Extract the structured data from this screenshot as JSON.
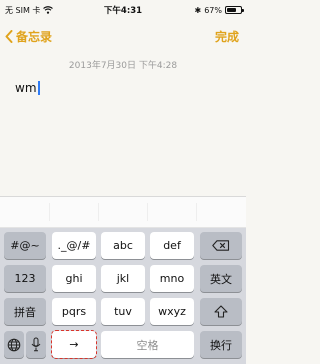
{
  "status": {
    "carrier": "无 SIM 卡",
    "time": "下午4:31",
    "bluetooth": "✱",
    "battery": "67%",
    "battery_level": 0.67
  },
  "nav": {
    "back_label": "备忘录",
    "done_label": "完成"
  },
  "note": {
    "date": "2013年7月30日 下午4:28",
    "text": "wm"
  },
  "keyboard": {
    "left_col": [
      "#@~",
      "123",
      "拼音"
    ],
    "row1": [
      "._@/#",
      "abc",
      "def"
    ],
    "row2": [
      "ghi",
      "jkl",
      "mno"
    ],
    "row3": [
      "pqrs",
      "tuv",
      "wxyz"
    ],
    "right_col": [
      "⌫",
      "英文",
      "⇧"
    ],
    "globe": "🌐",
    "mic": "🎤",
    "next_cursor": "→",
    "space": "空格",
    "return": "换行"
  },
  "icons": {
    "back": "chevron-left-icon",
    "wifi": "wifi-icon",
    "bluetooth": "bluetooth-icon",
    "backspace": "backspace-icon",
    "shift": "shift-icon",
    "globe": "globe-icon",
    "mic": "microphone-icon"
  },
  "colors": {
    "accent": "#e0a31c",
    "cursor": "#2f7cf6",
    "highlight": "#d9342b"
  }
}
